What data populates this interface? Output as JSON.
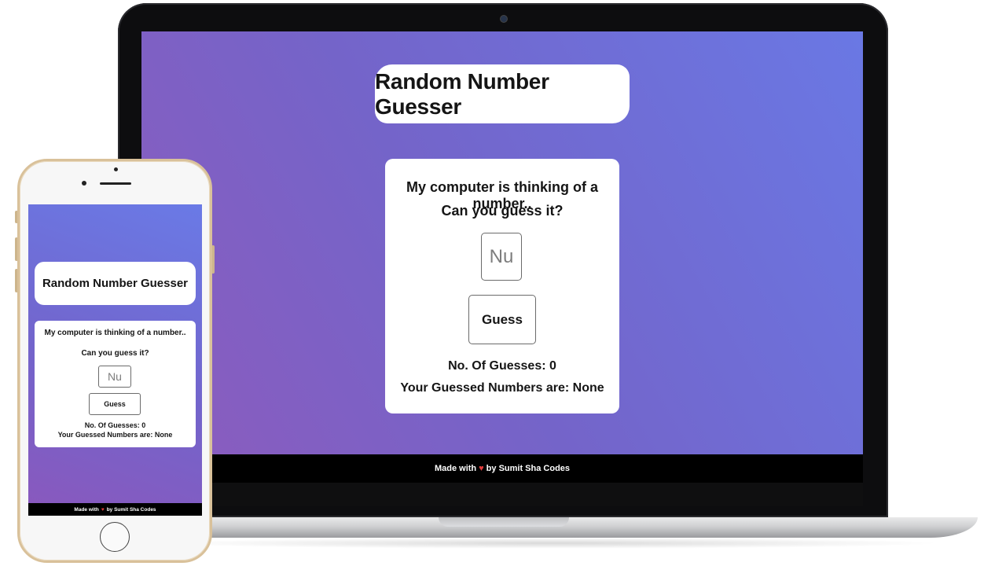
{
  "app": {
    "title": "Random Number Guesser",
    "prompt_line1": "My computer is thinking of a number..",
    "prompt_line2": "Can you guess it?",
    "input_placeholder": "Nu",
    "guess_button": "Guess",
    "guesses_label": "No. Of Guesses: 0",
    "guessed_numbers_label": "Your Guessed Numbers are: None",
    "footer_prefix": "Made with",
    "footer_suffix": "by Sumit Sha Codes"
  },
  "colors": {
    "gradient_start": "#8d5bbd",
    "gradient_end": "#6a78e4",
    "heart": "#e23c3c",
    "footer_bg": "#000000"
  },
  "icons": {
    "heart": "heart-icon"
  }
}
